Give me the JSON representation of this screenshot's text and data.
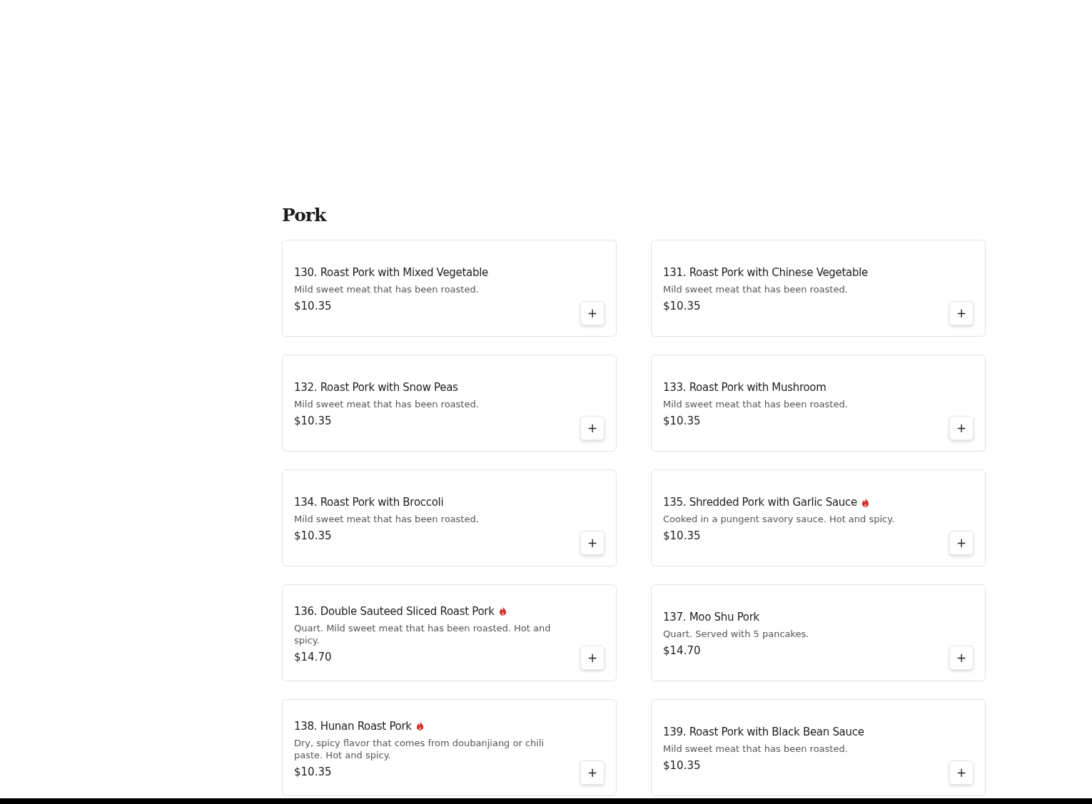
{
  "section": {
    "title": "Pork"
  },
  "items": [
    {
      "name": "130. Roast Pork with Mixed Vegetable",
      "spicy": false,
      "description": "Mild sweet meat that has been roasted.",
      "price": "$10.35",
      "add": "+"
    },
    {
      "name": "131. Roast Pork with Chinese Vegetable",
      "spicy": false,
      "description": "Mild sweet meat that has been roasted.",
      "price": "$10.35",
      "add": "+"
    },
    {
      "name": "132. Roast Pork with Snow Peas",
      "spicy": false,
      "description": "Mild sweet meat that has been roasted.",
      "price": "$10.35",
      "add": "+"
    },
    {
      "name": "133. Roast Pork with Mushroom",
      "spicy": false,
      "description": "Mild sweet meat that has been roasted.",
      "price": "$10.35",
      "add": "+"
    },
    {
      "name": "134. Roast Pork with Broccoli",
      "spicy": false,
      "description": "Mild sweet meat that has been roasted.",
      "price": "$10.35",
      "add": "+"
    },
    {
      "name": "135. Shredded Pork with Garlic Sauce",
      "spicy": true,
      "description": "Cooked in a pungent savory sauce. Hot and spicy.",
      "price": "$10.35",
      "add": "+"
    },
    {
      "name": "136. Double Sauteed Sliced Roast Pork",
      "spicy": true,
      "description": "Quart. Mild sweet meat that has been roasted. Hot and spicy.",
      "price": "$14.70",
      "add": "+"
    },
    {
      "name": "137. Moo Shu Pork",
      "spicy": false,
      "description": "Quart. Served with 5 pancakes.",
      "price": "$14.70",
      "add": "+"
    },
    {
      "name": "138. Hunan Roast Pork",
      "spicy": true,
      "description": "Dry, spicy flavor that comes from doubanjiang or chili paste. Hot and spicy.",
      "price": "$10.35",
      "add": "+"
    },
    {
      "name": "139. Roast Pork with Black Bean Sauce",
      "spicy": false,
      "description": "Mild sweet meat that has been roasted.",
      "price": "$10.35",
      "add": "+"
    }
  ]
}
